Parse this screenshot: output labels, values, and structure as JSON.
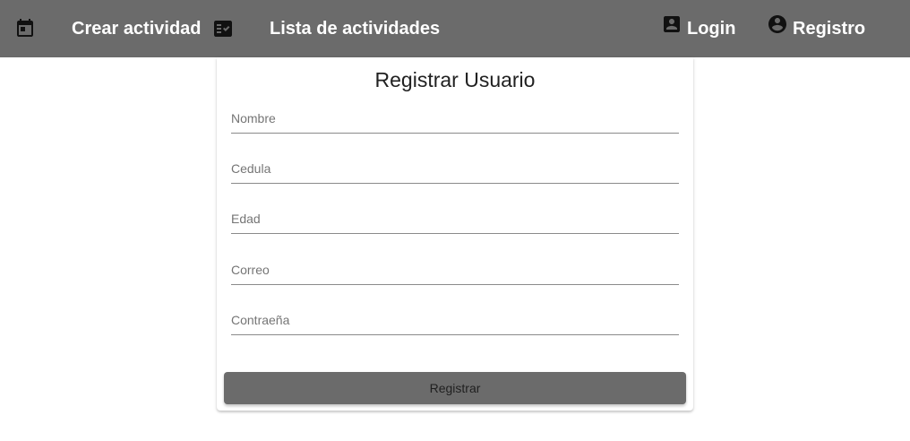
{
  "nav": {
    "crear": {
      "icon": "calendar-icon",
      "label": "Crear actividad"
    },
    "lista": {
      "icon": "checklist-icon",
      "label": "Lista de actividades"
    },
    "login": {
      "icon": "contact-card-icon",
      "label": "Login"
    },
    "registro": {
      "icon": "account-circle-icon",
      "label": "Registro"
    }
  },
  "form": {
    "title": "Registrar Usuario",
    "fields": [
      {
        "placeholder": "Nombre",
        "value": ""
      },
      {
        "placeholder": "Cedula",
        "value": ""
      },
      {
        "placeholder": "Edad",
        "value": ""
      },
      {
        "placeholder": "Correo",
        "value": ""
      },
      {
        "placeholder": "Contraeña",
        "value": ""
      }
    ],
    "submit_label": "Registrar"
  },
  "colors": {
    "navbar": "#6b6b6b",
    "button": "#6b6b6b"
  }
}
